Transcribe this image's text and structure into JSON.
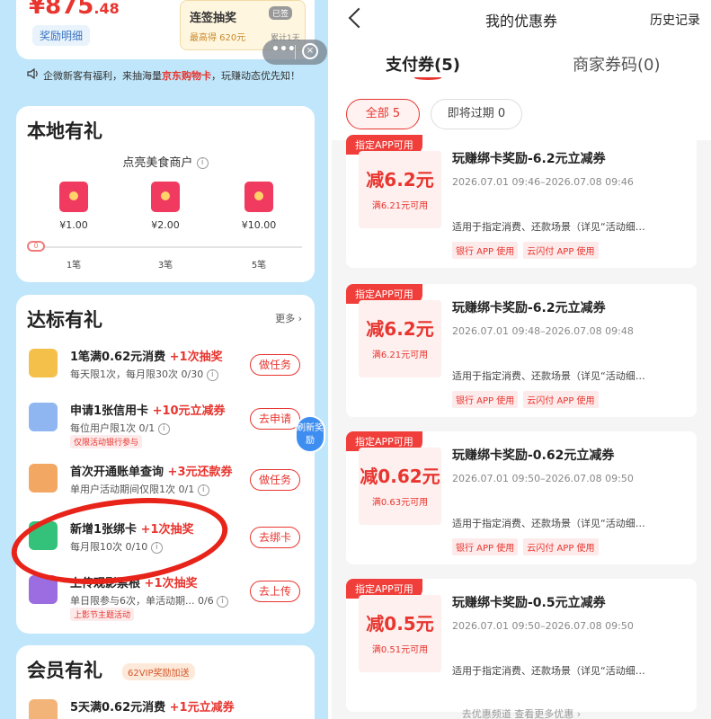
{
  "left": {
    "amount_main": "¥875",
    "amount_dec": ".48",
    "reward_detail": "奖励明细",
    "sign": {
      "title": "连签抽奖",
      "sub": "最高得 620元",
      "badge": "已签",
      "streak": "累计1天"
    },
    "capsule": {
      "more": "•••",
      "close": "×"
    },
    "notice": {
      "prefix": "企微新客有福利，来抽海量",
      "highlight": "京东购物卡",
      "suffix": "，玩赚动态优先知！"
    },
    "local": {
      "title": "本地有礼",
      "subtitle": "点亮美食商户",
      "rewards": [
        "¥1.00",
        "¥2.00",
        "¥10.00"
      ],
      "ticks": [
        "1笔",
        "3笔",
        "5笔"
      ],
      "start": "0"
    },
    "target": {
      "title": "达标有礼",
      "more": "更多 ›",
      "tasks": [
        {
          "title": "1笔满0.62元消费",
          "reward": "+1次抽奖",
          "sub": "每天限1次，每月限30次 0/30",
          "tag": "",
          "button": "做任务"
        },
        {
          "title": "申请1张信用卡",
          "reward": "+10元立减券",
          "sub": "每位用户限1次 0/1",
          "tag": "仅限活动银行参与",
          "button": "去申请"
        },
        {
          "title": "首次开通账单查询",
          "reward": "+3元还款券",
          "sub": "单用户活动期间仅限1次 0/1",
          "tag": "",
          "button": "做任务"
        },
        {
          "title": "新增1张绑卡",
          "reward": "+1次抽奖",
          "sub": "每月限10次 0/10",
          "tag": "",
          "button": "去绑卡"
        },
        {
          "title": "上传观影票根",
          "reward": "+1次抽奖",
          "sub": "单日限参与6次，单活动期... 0/6",
          "tag": "上影节主题活动",
          "button": "去上传"
        }
      ],
      "refresh": "刷新奖励"
    },
    "member": {
      "title": "会员有礼",
      "tag": "62VIP奖励加送",
      "task_title": "5天满0.62元消费",
      "task_reward": "+1元立减券"
    }
  },
  "right": {
    "title": "我的优惠券",
    "history": "历史记录",
    "tabs": {
      "pay": "支付券(5)",
      "merchant": "商家券码(0)"
    },
    "filters": {
      "all": "全部 5",
      "expiring": "即将过期 0"
    },
    "coupons": [
      {
        "flag": "指定APP可用",
        "amount": "减6.2元",
        "cond": "满6.21元可用",
        "title": "玩赚绑卡奖励-6.2元立减券",
        "date": "2026.07.01 09:46–2026.07.08 09:46",
        "desc": "适用于指定消费、还款场景（详见“活动细…",
        "tags": [
          "银行 APP 使用",
          "云闪付 APP 使用"
        ]
      },
      {
        "flag": "指定APP可用",
        "amount": "减6.2元",
        "cond": "满6.21元可用",
        "title": "玩赚绑卡奖励-6.2元立减券",
        "date": "2026.07.01 09:48–2026.07.08 09:48",
        "desc": "适用于指定消费、还款场景（详见“活动细…",
        "tags": [
          "银行 APP 使用",
          "云闪付 APP 使用"
        ]
      },
      {
        "flag": "指定APP可用",
        "amount": "减0.62元",
        "cond": "满0.63元可用",
        "title": "玩赚绑卡奖励-0.62元立减券",
        "date": "2026.07.01 09:50–2026.07.08 09:50",
        "desc": "适用于指定消费、还款场景（详见“活动细…",
        "tags": [
          "银行 APP 使用",
          "云闪付 APP 使用"
        ]
      },
      {
        "flag": "指定APP可用",
        "amount": "减0.5元",
        "cond": "满0.51元可用",
        "title": "玩赚绑卡奖励-0.5元立减券",
        "date": "2026.07.01 09:50–2026.07.08 09:50",
        "desc": "适用于指定消费、还款场景（详见“活动细…",
        "tags": []
      }
    ],
    "footer": "去优惠频道 查看更多优惠 ›"
  }
}
